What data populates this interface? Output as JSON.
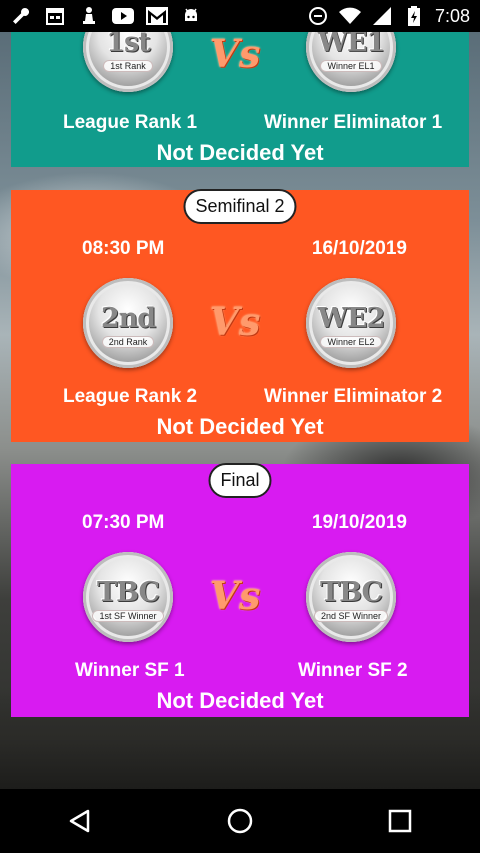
{
  "status_bar": {
    "time": "7:08",
    "icons_left": [
      "wrench-icon",
      "calendar-icon",
      "chess-icon",
      "youtube-icon",
      "gmail-icon",
      "android-icon"
    ],
    "icons_right": [
      "sync-icon",
      "wifi-icon",
      "signal-icon",
      "battery-icon"
    ]
  },
  "matches": [
    {
      "pill": "",
      "time": "",
      "date": "",
      "left_badge": {
        "big": "1st",
        "small": "1st Rank"
      },
      "right_badge": {
        "big": "WE1",
        "small": "Winner EL1"
      },
      "vs": "Vs",
      "left_team": "League Rank 1",
      "right_team": "Winner Eliminator 1",
      "status": "Not Decided Yet",
      "color": "#119c8c"
    },
    {
      "pill": "Semifinal 2",
      "time": "08:30 PM",
      "date": "16/10/2019",
      "left_badge": {
        "big": "2nd",
        "small": "2nd Rank"
      },
      "right_badge": {
        "big": "WE2",
        "small": "Winner EL2"
      },
      "vs": "Vs",
      "left_team": "League Rank 2",
      "right_team": "Winner Eliminator 2",
      "status": "Not Decided Yet",
      "color": "#ff5722"
    },
    {
      "pill": "Final",
      "time": "07:30 PM",
      "date": "19/10/2019",
      "left_badge": {
        "big": "TBC",
        "small": "1st SF Winner"
      },
      "right_badge": {
        "big": "TBC",
        "small": "2nd SF Winner"
      },
      "vs": "Vs",
      "left_team": "Winner SF 1",
      "right_team": "Winner SF 2",
      "status": "Not Decided Yet",
      "color": "#d81bf1"
    }
  ],
  "nav_bar": {
    "icons": [
      "back-icon",
      "home-icon",
      "recents-icon"
    ]
  }
}
